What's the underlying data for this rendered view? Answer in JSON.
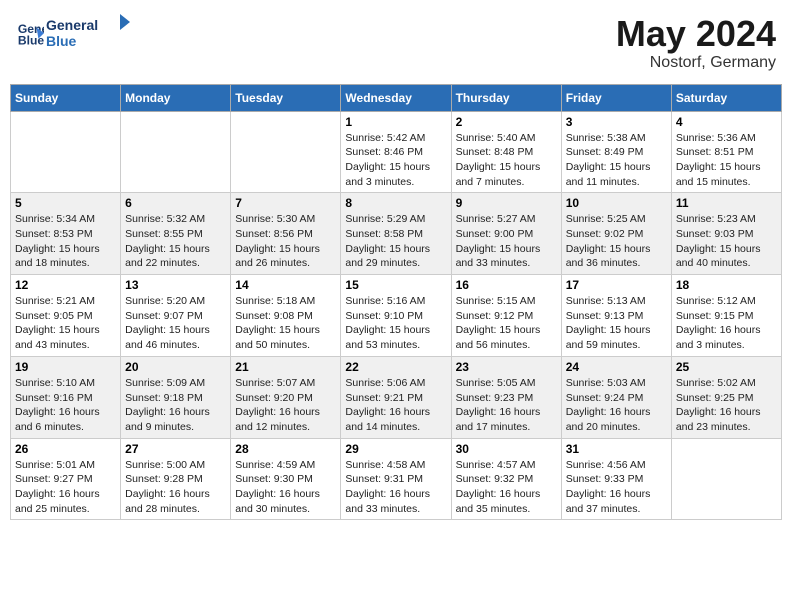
{
  "header": {
    "logo_line1": "General",
    "logo_line2": "Blue",
    "month": "May 2024",
    "location": "Nostorf, Germany"
  },
  "weekdays": [
    "Sunday",
    "Monday",
    "Tuesday",
    "Wednesday",
    "Thursday",
    "Friday",
    "Saturday"
  ],
  "weeks": [
    [
      {
        "day": "",
        "info": ""
      },
      {
        "day": "",
        "info": ""
      },
      {
        "day": "",
        "info": ""
      },
      {
        "day": "1",
        "info": "Sunrise: 5:42 AM\nSunset: 8:46 PM\nDaylight: 15 hours\nand 3 minutes."
      },
      {
        "day": "2",
        "info": "Sunrise: 5:40 AM\nSunset: 8:48 PM\nDaylight: 15 hours\nand 7 minutes."
      },
      {
        "day": "3",
        "info": "Sunrise: 5:38 AM\nSunset: 8:49 PM\nDaylight: 15 hours\nand 11 minutes."
      },
      {
        "day": "4",
        "info": "Sunrise: 5:36 AM\nSunset: 8:51 PM\nDaylight: 15 hours\nand 15 minutes."
      }
    ],
    [
      {
        "day": "5",
        "info": "Sunrise: 5:34 AM\nSunset: 8:53 PM\nDaylight: 15 hours\nand 18 minutes."
      },
      {
        "day": "6",
        "info": "Sunrise: 5:32 AM\nSunset: 8:55 PM\nDaylight: 15 hours\nand 22 minutes."
      },
      {
        "day": "7",
        "info": "Sunrise: 5:30 AM\nSunset: 8:56 PM\nDaylight: 15 hours\nand 26 minutes."
      },
      {
        "day": "8",
        "info": "Sunrise: 5:29 AM\nSunset: 8:58 PM\nDaylight: 15 hours\nand 29 minutes."
      },
      {
        "day": "9",
        "info": "Sunrise: 5:27 AM\nSunset: 9:00 PM\nDaylight: 15 hours\nand 33 minutes."
      },
      {
        "day": "10",
        "info": "Sunrise: 5:25 AM\nSunset: 9:02 PM\nDaylight: 15 hours\nand 36 minutes."
      },
      {
        "day": "11",
        "info": "Sunrise: 5:23 AM\nSunset: 9:03 PM\nDaylight: 15 hours\nand 40 minutes."
      }
    ],
    [
      {
        "day": "12",
        "info": "Sunrise: 5:21 AM\nSunset: 9:05 PM\nDaylight: 15 hours\nand 43 minutes."
      },
      {
        "day": "13",
        "info": "Sunrise: 5:20 AM\nSunset: 9:07 PM\nDaylight: 15 hours\nand 46 minutes."
      },
      {
        "day": "14",
        "info": "Sunrise: 5:18 AM\nSunset: 9:08 PM\nDaylight: 15 hours\nand 50 minutes."
      },
      {
        "day": "15",
        "info": "Sunrise: 5:16 AM\nSunset: 9:10 PM\nDaylight: 15 hours\nand 53 minutes."
      },
      {
        "day": "16",
        "info": "Sunrise: 5:15 AM\nSunset: 9:12 PM\nDaylight: 15 hours\nand 56 minutes."
      },
      {
        "day": "17",
        "info": "Sunrise: 5:13 AM\nSunset: 9:13 PM\nDaylight: 15 hours\nand 59 minutes."
      },
      {
        "day": "18",
        "info": "Sunrise: 5:12 AM\nSunset: 9:15 PM\nDaylight: 16 hours\nand 3 minutes."
      }
    ],
    [
      {
        "day": "19",
        "info": "Sunrise: 5:10 AM\nSunset: 9:16 PM\nDaylight: 16 hours\nand 6 minutes."
      },
      {
        "day": "20",
        "info": "Sunrise: 5:09 AM\nSunset: 9:18 PM\nDaylight: 16 hours\nand 9 minutes."
      },
      {
        "day": "21",
        "info": "Sunrise: 5:07 AM\nSunset: 9:20 PM\nDaylight: 16 hours\nand 12 minutes."
      },
      {
        "day": "22",
        "info": "Sunrise: 5:06 AM\nSunset: 9:21 PM\nDaylight: 16 hours\nand 14 minutes."
      },
      {
        "day": "23",
        "info": "Sunrise: 5:05 AM\nSunset: 9:23 PM\nDaylight: 16 hours\nand 17 minutes."
      },
      {
        "day": "24",
        "info": "Sunrise: 5:03 AM\nSunset: 9:24 PM\nDaylight: 16 hours\nand 20 minutes."
      },
      {
        "day": "25",
        "info": "Sunrise: 5:02 AM\nSunset: 9:25 PM\nDaylight: 16 hours\nand 23 minutes."
      }
    ],
    [
      {
        "day": "26",
        "info": "Sunrise: 5:01 AM\nSunset: 9:27 PM\nDaylight: 16 hours\nand 25 minutes."
      },
      {
        "day": "27",
        "info": "Sunrise: 5:00 AM\nSunset: 9:28 PM\nDaylight: 16 hours\nand 28 minutes."
      },
      {
        "day": "28",
        "info": "Sunrise: 4:59 AM\nSunset: 9:30 PM\nDaylight: 16 hours\nand 30 minutes."
      },
      {
        "day": "29",
        "info": "Sunrise: 4:58 AM\nSunset: 9:31 PM\nDaylight: 16 hours\nand 33 minutes."
      },
      {
        "day": "30",
        "info": "Sunrise: 4:57 AM\nSunset: 9:32 PM\nDaylight: 16 hours\nand 35 minutes."
      },
      {
        "day": "31",
        "info": "Sunrise: 4:56 AM\nSunset: 9:33 PM\nDaylight: 16 hours\nand 37 minutes."
      },
      {
        "day": "",
        "info": ""
      }
    ]
  ]
}
